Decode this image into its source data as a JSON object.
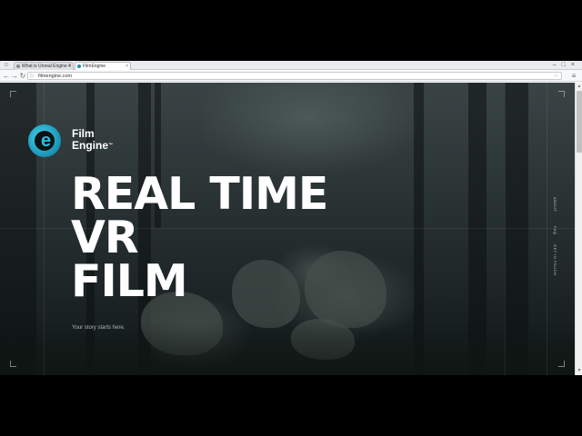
{
  "browser": {
    "tabs": [
      {
        "label": "What is Unreal Engine 4",
        "active": false
      },
      {
        "label": "FilmEngine",
        "active": true
      }
    ],
    "url": "filmengine.com",
    "icons": {
      "user": "user-icon",
      "back": "back-icon",
      "forward": "forward-icon",
      "reload": "reload-icon",
      "bookmark": "star-icon",
      "menu": "menu-icon"
    }
  },
  "site": {
    "logo": {
      "line1": "Film",
      "line2": "Engine",
      "tm": "™",
      "mark_letter": "e"
    },
    "headline": {
      "line1": "REAL TIME",
      "line2": "VR",
      "line3": "FILM"
    },
    "tagline": "Your story starts here.",
    "side_nav": [
      "ABOUT",
      "FAQ",
      "GET IN TOUCH"
    ],
    "colors": {
      "accent": "#2bc0de"
    }
  }
}
